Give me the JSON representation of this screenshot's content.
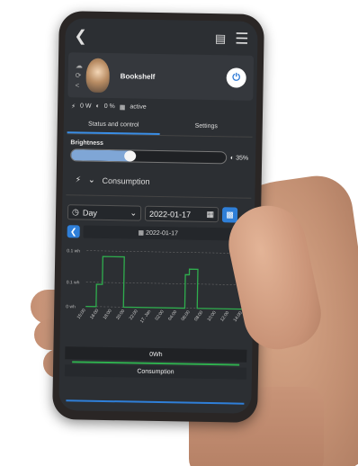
{
  "device": {
    "name": "Bookshelf"
  },
  "status": {
    "power": "0 W",
    "level": "0 %",
    "state": "active"
  },
  "tabs": {
    "status_control": "Status and control",
    "settings": "Settings"
  },
  "brightness": {
    "label": "Brightness",
    "value_label": "35%",
    "value": 0.35
  },
  "consumption": {
    "label": "Consumption"
  },
  "filters": {
    "period": "Day",
    "date": "2022-01-17",
    "nav_date": "2022-01-17"
  },
  "chart_data": {
    "type": "line",
    "y_tick_labels": [
      "0.1 wh",
      "0.1 wh",
      "0 wh"
    ],
    "ylim": [
      0,
      0.1
    ],
    "categories": [
      "15:00",
      "16:00",
      "18:00",
      "20:00",
      "22:00",
      "17. Jan",
      "02:00",
      "04:00",
      "06:00",
      "08:00",
      "10:00",
      "12:00",
      "14:00"
    ],
    "series": [
      {
        "color": "#2fae4e",
        "points": [
          [
            0,
            0
          ],
          [
            0.8,
            0
          ],
          [
            0.8,
            0.04
          ],
          [
            1.25,
            0.04
          ],
          [
            1.25,
            0.09
          ],
          [
            2.9,
            0.09
          ],
          [
            2.9,
            0
          ],
          [
            7.6,
            0
          ],
          [
            7.6,
            0.06
          ],
          [
            7.9,
            0.06
          ],
          [
            7.9,
            0.07
          ],
          [
            8.55,
            0.07
          ],
          [
            8.55,
            0
          ],
          [
            12,
            0
          ]
        ]
      }
    ]
  },
  "summary": {
    "total": "0Wh",
    "label": "Consumption"
  }
}
